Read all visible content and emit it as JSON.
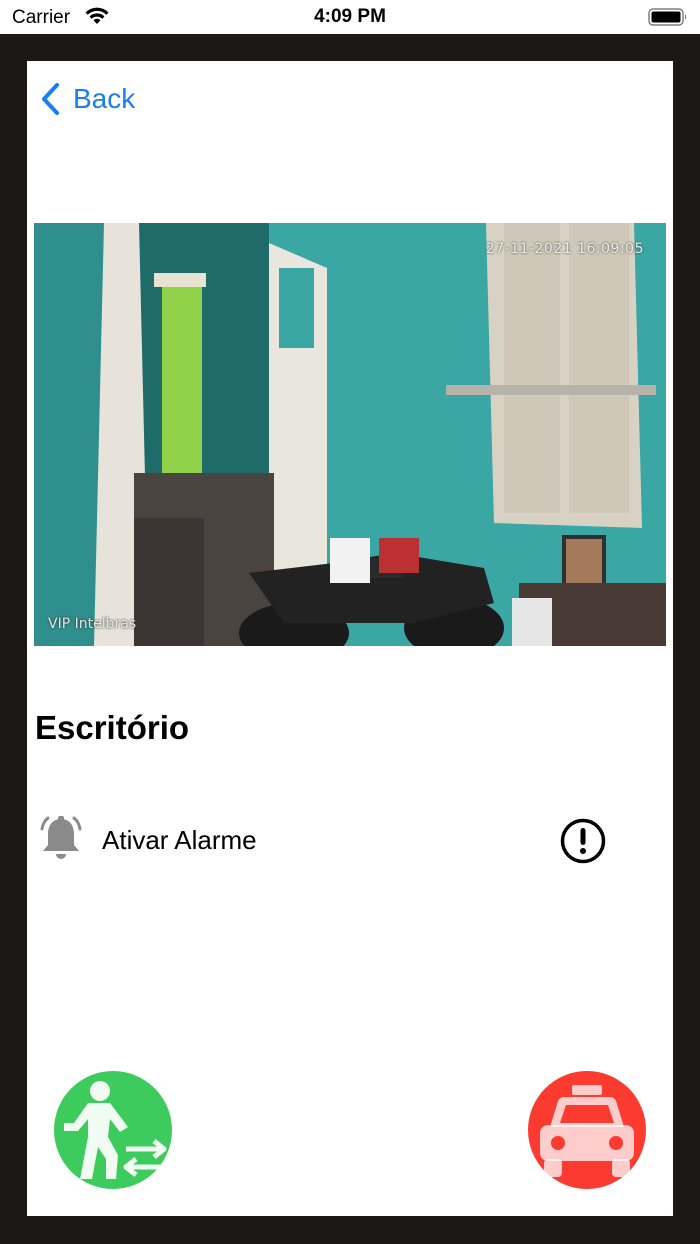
{
  "status_bar": {
    "carrier": "Carrier",
    "time": "4:09 PM",
    "icons": [
      "wifi-icon",
      "battery-icon"
    ]
  },
  "nav": {
    "back_label": "Back",
    "accent_color": "#1a7df2"
  },
  "camera": {
    "timestamp": "27-11-2021 16:09:05",
    "brand": "VIP Intelbras",
    "title": "Escritório"
  },
  "alarm": {
    "label": "Ativar Alarme",
    "icons": [
      "bell-icon",
      "alert-circle-icon"
    ]
  },
  "actions": {
    "pedestrian": {
      "icon": "pedestrian-entry-icon",
      "color": "#3ecb5d"
    },
    "vehicle": {
      "icon": "car-icon",
      "color": "#fb3b30"
    }
  }
}
